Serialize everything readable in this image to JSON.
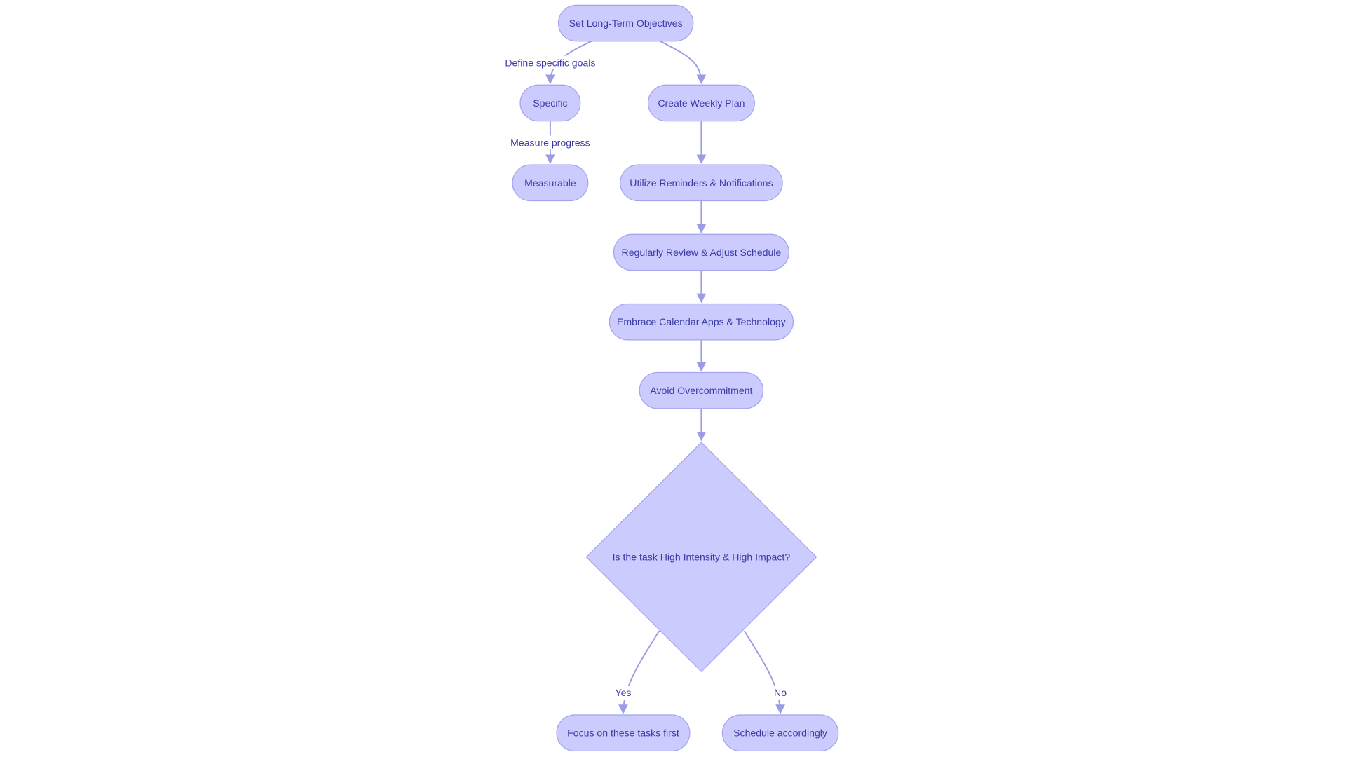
{
  "diagram": {
    "type": "flowchart",
    "colors": {
      "node_fill": "#cbcbfd",
      "node_stroke": "#a3a3ee",
      "text": "#3b3ba8",
      "edge": "#9b9be6"
    },
    "nodes": {
      "objectives": {
        "label": "Set Long-Term Objectives",
        "shape": "rounded"
      },
      "specific": {
        "label": "Specific",
        "shape": "rounded"
      },
      "weekly": {
        "label": "Create Weekly Plan",
        "shape": "rounded"
      },
      "measurable": {
        "label": "Measurable",
        "shape": "rounded"
      },
      "reminders": {
        "label": "Utilize Reminders & Notifications",
        "shape": "rounded"
      },
      "review": {
        "label": "Regularly Review & Adjust Schedule",
        "shape": "rounded"
      },
      "apps": {
        "label": "Embrace Calendar Apps & Technology",
        "shape": "rounded"
      },
      "avoid": {
        "label": "Avoid Overcommitment",
        "shape": "rounded"
      },
      "decision": {
        "label": "Is the task High Intensity & High Impact?",
        "shape": "diamond"
      },
      "focus": {
        "label": "Focus on these tasks first",
        "shape": "rounded"
      },
      "schedule": {
        "label": "Schedule accordingly",
        "shape": "rounded"
      }
    },
    "edges": [
      {
        "from": "objectives",
        "to": "specific",
        "label": "Define specific goals"
      },
      {
        "from": "objectives",
        "to": "weekly",
        "label": ""
      },
      {
        "from": "specific",
        "to": "measurable",
        "label": "Measure progress"
      },
      {
        "from": "weekly",
        "to": "reminders",
        "label": ""
      },
      {
        "from": "reminders",
        "to": "review",
        "label": ""
      },
      {
        "from": "review",
        "to": "apps",
        "label": ""
      },
      {
        "from": "apps",
        "to": "avoid",
        "label": ""
      },
      {
        "from": "avoid",
        "to": "decision",
        "label": ""
      },
      {
        "from": "decision",
        "to": "focus",
        "label": "Yes"
      },
      {
        "from": "decision",
        "to": "schedule",
        "label": "No"
      }
    ]
  }
}
